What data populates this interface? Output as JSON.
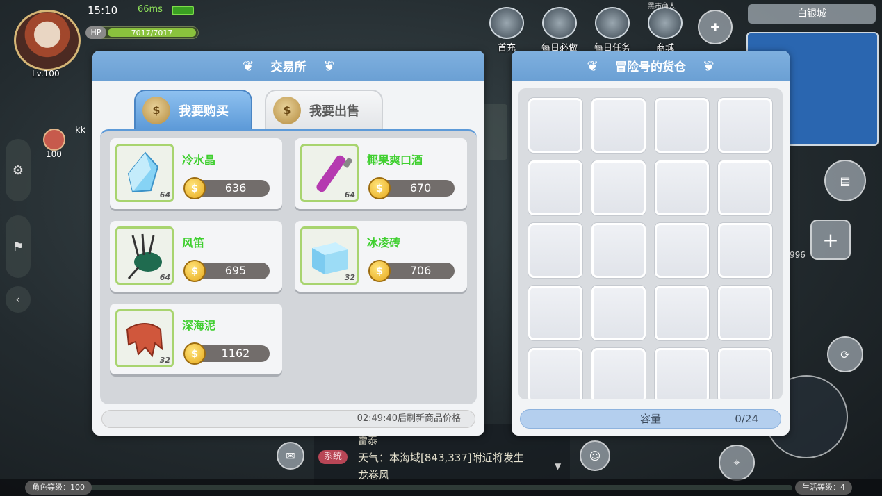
{
  "hud": {
    "time": "15:10",
    "ping": "66ms",
    "hp_label": "HP",
    "hp_value": "7017/7017",
    "player_level": "Lv.100",
    "pet_name": "kk",
    "pet_level": "100",
    "city": "白银城",
    "top_icons": [
      "首充",
      "每日必做",
      "每日任务",
      "商城"
    ],
    "npc_label": "黑市商人",
    "side_number": "996",
    "chat": {
      "line0": "雷泰",
      "tag": "系统",
      "line1": "天气：本海域[843,337]附近将发生",
      "line2": "龙卷风"
    },
    "role_level_label": "角色等级：100",
    "life_level_label": "生活等级：4"
  },
  "exchange": {
    "title": "交易所",
    "tab_buy": "我要购买",
    "tab_sell": "我要出售",
    "coin_symbol": "$",
    "items": [
      {
        "name": "冷水晶",
        "price": "636",
        "count": "64",
        "icon": "crystal-icon"
      },
      {
        "name": "椰果爽口酒",
        "price": "670",
        "count": "64",
        "icon": "bottle-icon"
      },
      {
        "name": "风笛",
        "price": "695",
        "count": "64",
        "icon": "bagpipe-icon"
      },
      {
        "name": "冰凌砖",
        "price": "706",
        "count": "32",
        "icon": "ice-brick-icon"
      },
      {
        "name": "深海泥",
        "price": "1162",
        "count": "32",
        "icon": "deep-sea-mud-icon"
      }
    ],
    "refresh_text": "02:49:40后刷新商品价格"
  },
  "warehouse": {
    "title": "冒险号的货仓",
    "capacity_label": "容量",
    "capacity_value": "0/24"
  },
  "colors": {
    "header_blue": "#6ba0d4",
    "item_name_green": "#3fcf2f",
    "price_bar": "#726d6b",
    "capacity_bar": "#b4cfee"
  }
}
